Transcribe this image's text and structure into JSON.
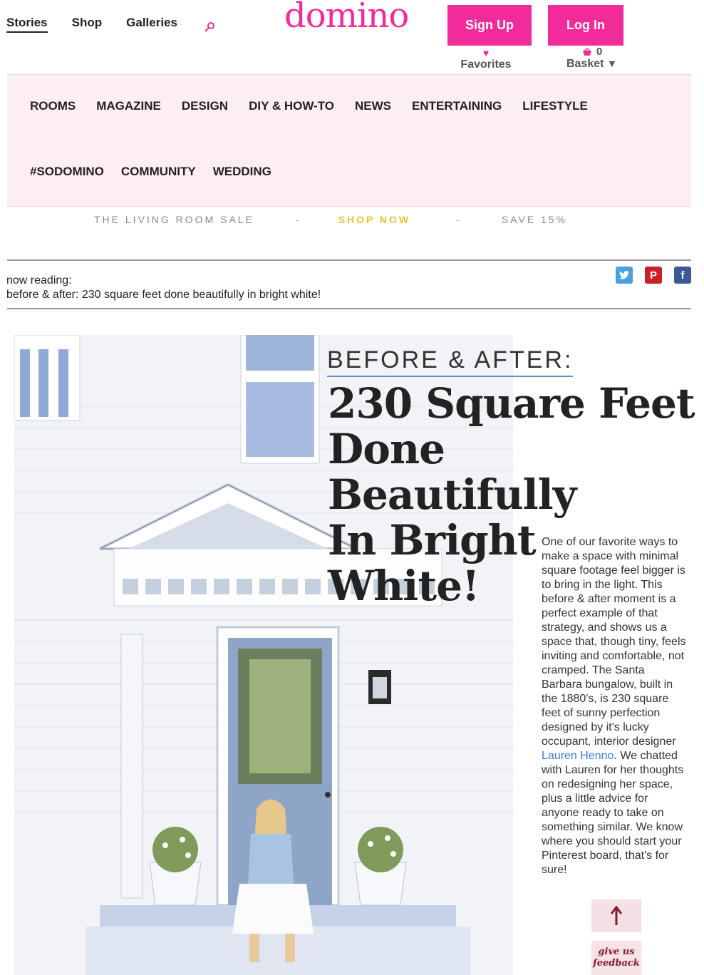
{
  "header": {
    "nav": [
      "Stories",
      "Shop",
      "Galleries"
    ],
    "logo": "domino",
    "signup_label": "Sign Up",
    "login_label": "Log In",
    "favorites_label": "Favorites",
    "basket_label": "Basket",
    "basket_count": "0"
  },
  "menu": {
    "row1": [
      "ROOMS",
      "MAGAZINE",
      "DESIGN",
      "DIY & HOW-TO",
      "NEWS",
      "ENTERTAINING",
      "LIFESTYLE"
    ],
    "row2": [
      "#SODOMINO",
      "COMMUNITY",
      "WEDDING"
    ]
  },
  "sale": {
    "left": "THE LIVING ROOM SALE",
    "sep": "-",
    "cta": "SHOP NOW",
    "right": "SAVE 15%"
  },
  "now_reading": {
    "label": "now reading:",
    "title": "before & after: 230 square feet done beautifully in bright white!"
  },
  "article": {
    "kicker": "BEFORE & AFTER:",
    "headline_lines": [
      "230 Square Feet",
      "Done Beautifully",
      "In Bright White!"
    ],
    "body_before_link": "One of our favorite ways to make a space with minimal square footage feel bigger is to bring in the light. This before & after moment is a perfect example of that strategy, and shows us a space that, though tiny, feels inviting and comfortable, not cramped. The Santa Barbara bungalow, built in the 1880's, is 230 square feet of sunny perfection designed by it's lucky occupant, interior designer ",
    "link_text": "Lauren Henno",
    "body_after_link": ". We chatted with Lauren for her thoughts on redesigning her space, plus a little advice for anyone ready to take on something similar. We know where you should start your Pinterest board, that's for sure!",
    "feedback_label": "give us feedback"
  },
  "colors": {
    "brand_pink": "#f22b9a",
    "menu_bg": "#fdeef4",
    "sale_cta": "#f1c232"
  }
}
